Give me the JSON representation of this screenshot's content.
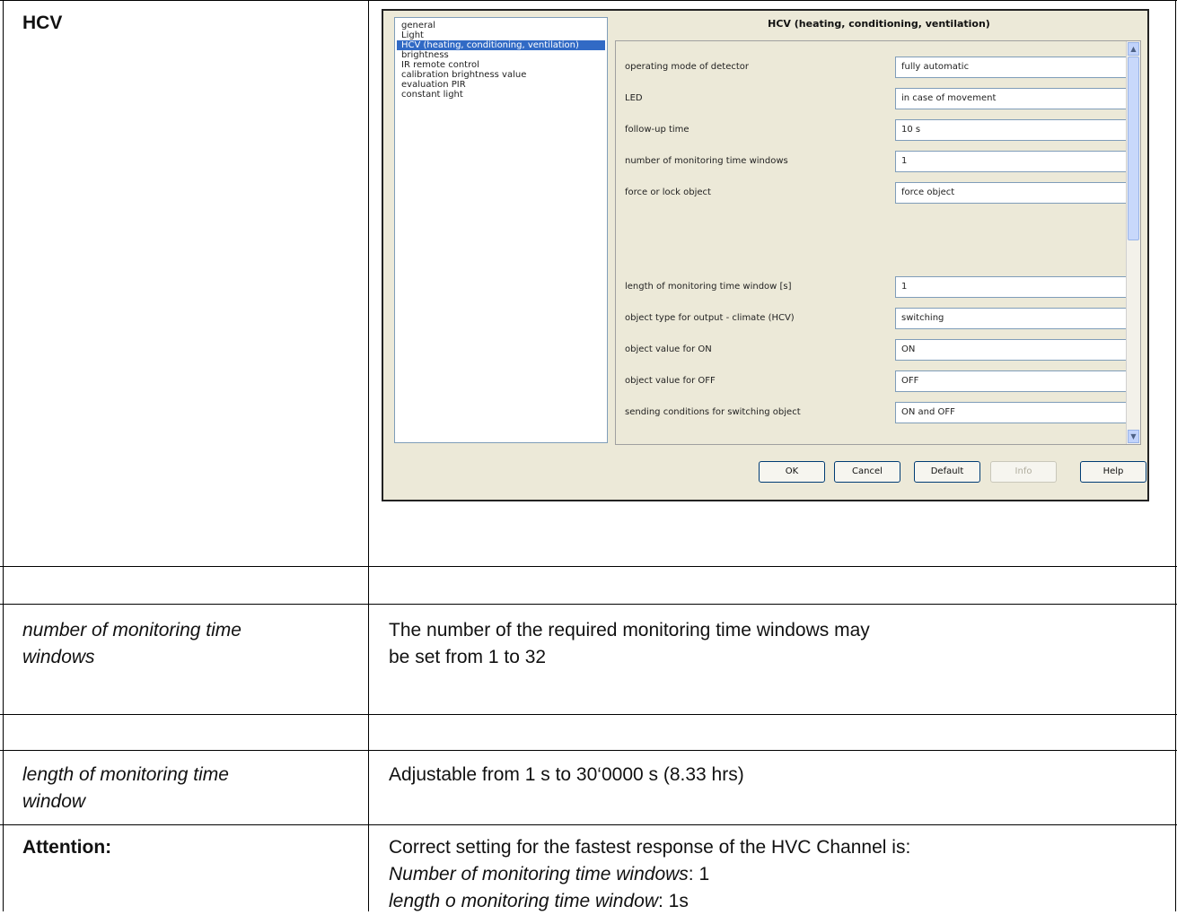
{
  "doc": {
    "row1_label": "HCV",
    "row2_label": "",
    "row3_label_line1": "number of monitoring time",
    "row3_label_line2": "windows",
    "row3_desc_line1": "The number of the required monitoring time windows may",
    "row3_desc_line2": "be set from 1 to 32",
    "row5_label_line1": "length of monitoring  time",
    "row5_label_line2": "window",
    "row5_desc": "Adjustable from 1 s to 30‘0000 s  (8.33 hrs)",
    "row6_label": "Attention:",
    "row6_line1": "Correct setting for the fastest response of the HVC Channel is:",
    "row6_line2_ital": "Number of monitoring time windows",
    "row6_line2_rest": ": 1",
    "row6_line3_ital": "length o monitoring time window",
    "row6_line3_rest": ": 1s"
  },
  "dialog": {
    "title": "HCV (heating, conditioning, ventilation)",
    "tree": [
      "general",
      "Light",
      "HCV (heating, conditioning, ventilation)",
      "brightness",
      "IR remote control",
      "calibration brightness value",
      "evaluation PIR",
      "constant light"
    ],
    "params": [
      {
        "label": "operating mode of detector",
        "value": "fully automatic"
      },
      {
        "label": "LED",
        "value": "in case of movement"
      },
      {
        "label": "follow-up time",
        "value": "10 s"
      },
      {
        "label": "number of monitoring time windows",
        "value": "1"
      },
      {
        "label": "force or lock object",
        "value": "force object"
      },
      {
        "label": "length of monitoring time window [s]",
        "value": "1"
      },
      {
        "label": "object type for output - climate (HCV)",
        "value": "switching"
      },
      {
        "label": "object value for ON",
        "value": "ON"
      },
      {
        "label": "object value for OFF",
        "value": "OFF"
      },
      {
        "label": "sending conditions for switching object",
        "value": "ON and OFF"
      }
    ],
    "buttons": {
      "ok": "OK",
      "cancel": "Cancel",
      "default": "Default",
      "info": "Info",
      "help": "Help"
    },
    "scroll_up": "▲",
    "scroll_down": "▼"
  }
}
